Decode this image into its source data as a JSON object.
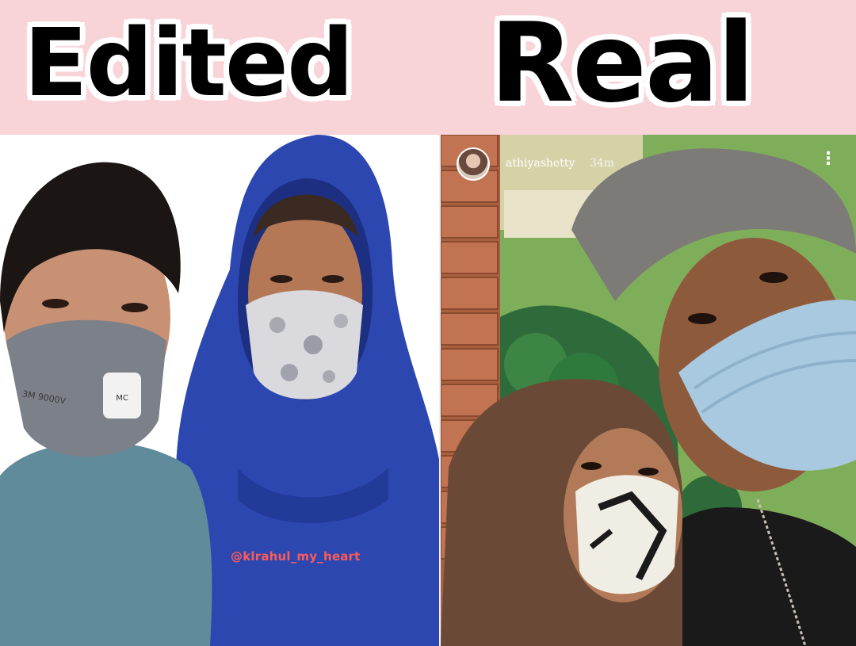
{
  "header": {
    "left_label": "Edited",
    "right_label": "Real"
  },
  "left_photo": {
    "watermark": "@klrahul_my_heart",
    "mask_text": "3M 9000V"
  },
  "right_photo": {
    "story_username": "athiyashetty",
    "story_time": "34m",
    "more_icon": "more-vertical-icon"
  },
  "colors": {
    "header_background": "#f8d3d8",
    "watermark": "#ff5a5a",
    "hoodie": "#2c47b0"
  }
}
